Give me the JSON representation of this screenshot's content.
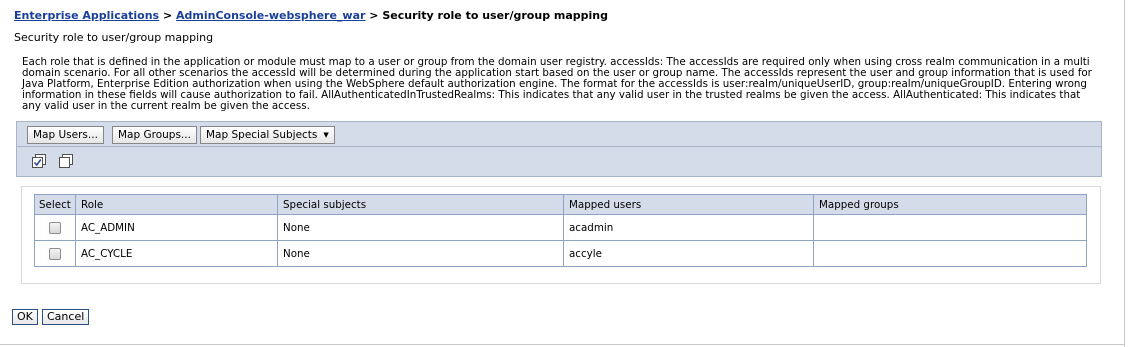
{
  "breadcrumb": {
    "items": [
      "Enterprise Applications",
      "AdminConsole-websphere_war"
    ],
    "separator": ">",
    "current": "Security role to user/group mapping"
  },
  "page": {
    "subtitle": "Security role to user/group mapping",
    "description": "Each role that is defined in the application or module must map to a user or group from the domain user registry. accessIds: The accessIds are required only when using cross realm communication in a multi domain scenario. For all other scenarios the accessId will be determined during the application start based on the user or group name. The accessIds represent the user and group information that is used for Java Platform, Enterprise Edition authorization when using the WebSphere default authorization engine. The format for the accessIds is user:realm/uniqueUserID, group:realm/uniqueGroupID. Entering wrong information in these fields will cause authorization to fail. AllAuthenticatedInTrustedRealms: This indicates that any valid user in the trusted realms be given the access. AllAuthenticated: This indicates that any valid user in the current realm be given the access."
  },
  "toolbar": {
    "map_users": "Map Users...",
    "map_groups": "Map Groups...",
    "map_special": "Map Special Subjects",
    "map_special_caret": "▼"
  },
  "icons": {
    "select_all": "select-all-icon",
    "deselect_all": "deselect-all-icon"
  },
  "table": {
    "columns": [
      "Select",
      "Role",
      "Special subjects",
      "Mapped users",
      "Mapped groups"
    ],
    "rows": [
      {
        "role": "AC_ADMIN",
        "special": "None",
        "users": "acadmin",
        "groups": ""
      },
      {
        "role": "AC_CYCLE",
        "special": "None",
        "users": "accyle",
        "groups": ""
      }
    ]
  },
  "footer": {
    "ok": "OK",
    "cancel": "Cancel"
  },
  "colors": {
    "link": "#1a3f9a",
    "toolbar_bg": "#d4dce9",
    "table_border": "#8fa4c4"
  }
}
